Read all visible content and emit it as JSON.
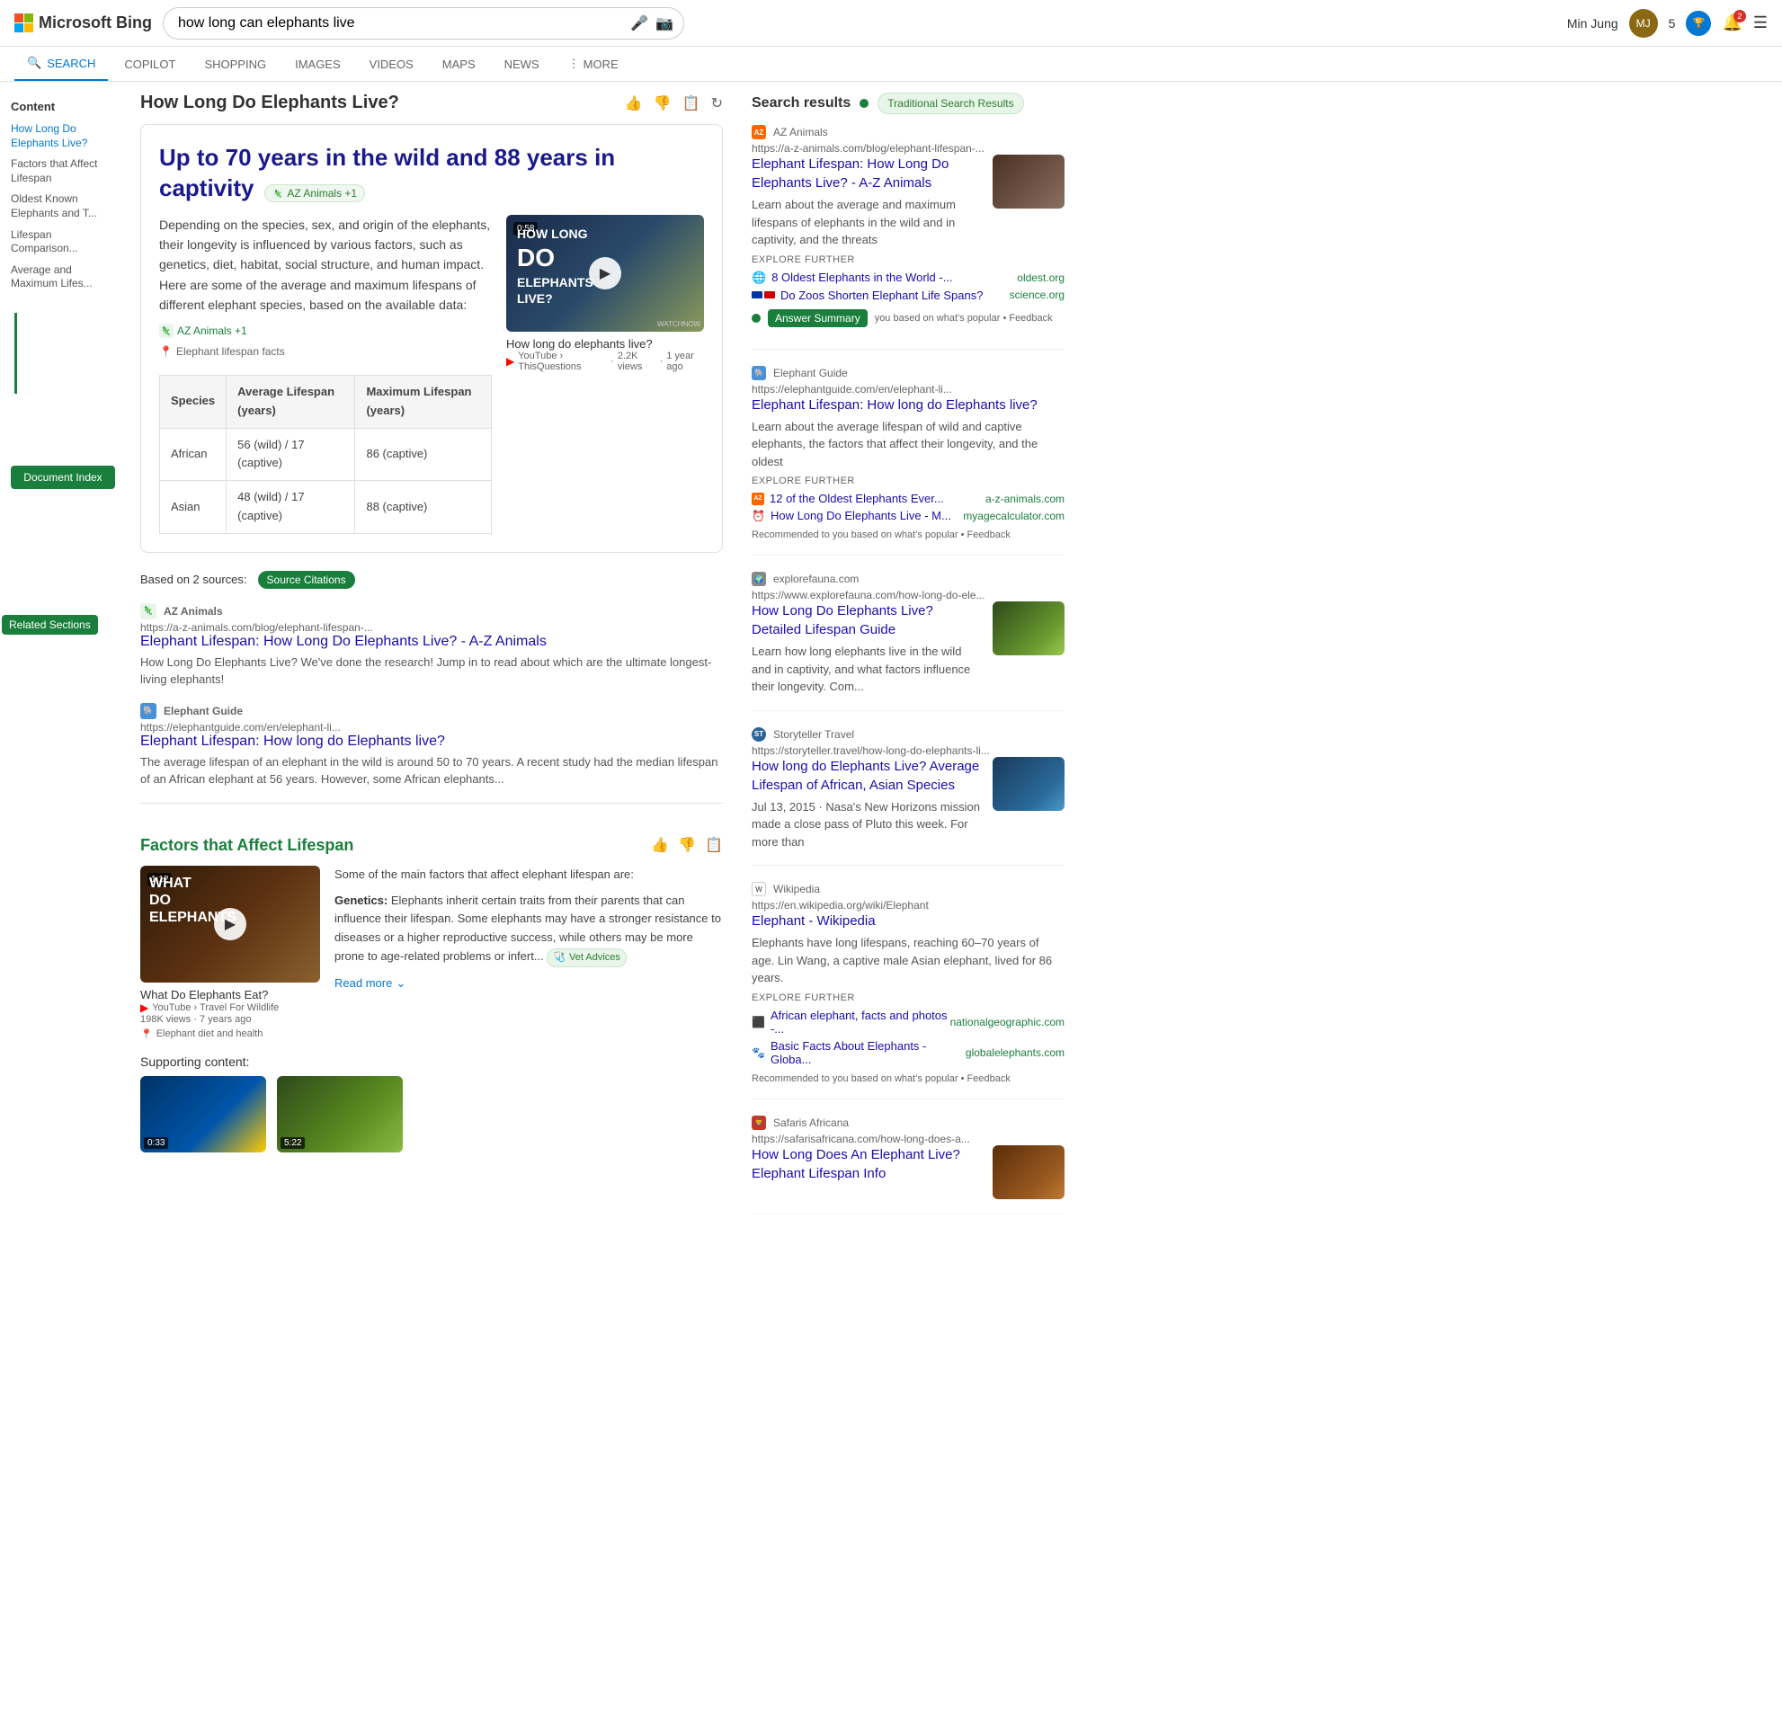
{
  "header": {
    "brand": "Microsoft Bing",
    "search_query": "how long can elephants live",
    "user_name": "Min Jung",
    "points": "5",
    "notif_count": "2"
  },
  "nav": {
    "tabs": [
      {
        "label": "SEARCH",
        "active": true,
        "icon": "search"
      },
      {
        "label": "COPILOT",
        "active": false
      },
      {
        "label": "SHOPPING",
        "active": false
      },
      {
        "label": "IMAGES",
        "active": false
      },
      {
        "label": "VIDEOS",
        "active": false
      },
      {
        "label": "MAPS",
        "active": false
      },
      {
        "label": "NEWS",
        "active": false
      },
      {
        "label": "MORE",
        "active": false,
        "has_more": true
      }
    ]
  },
  "left_sidebar": {
    "toc_title": "Content",
    "toc_items": [
      {
        "label": "How Long Do Elephants Live?",
        "active": true
      },
      {
        "label": "Factors that Affect Lifespan"
      },
      {
        "label": "Oldest Known Elephants and T..."
      },
      {
        "label": "Lifespan Comparison..."
      },
      {
        "label": "Average and Maximum Lifes..."
      }
    ],
    "doc_index_label": "Document Index",
    "related_sections_label": "Related Sections"
  },
  "main": {
    "page_title": "How Long Do Elephants Live?",
    "answer_headline": "Up to 70 years in the wild and 88 years in captivity",
    "source_badge": "AZ Animals +1",
    "answer_text": "Depending on the species, sex, and origin of the elephants, their longevity is influenced by various factors, such as genetics, diet, habitat, social structure, and human impact. Here are some of the average and maximum lifespans of different elephant species, based on the available data:",
    "answer_source_label": "AZ Animals +1",
    "elephant_facts_label": "Elephant lifespan facts",
    "video": {
      "duration": "0:58",
      "title": "How long do elephants live?",
      "channel": "YouTube › ThisQuestions",
      "views": "2.2K views",
      "time_ago": "1 year ago",
      "thumb_text_line1": "HOW LONG",
      "thumb_text_line2": "DO",
      "thumb_text_line3": "ELEPHANTS",
      "thumb_text_line4": "LIVE?"
    },
    "table": {
      "headers": [
        "Species",
        "Average Lifespan (years)",
        "Maximum Lifespan (years)"
      ],
      "rows": [
        [
          "African",
          "56 (wild) / 17 (captive)",
          "86 (captive)"
        ],
        [
          "Asian",
          "48 (wild) / 17 (captive)",
          "88 (captive)"
        ]
      ]
    },
    "sources_bar": {
      "label": "Based on 2 sources:",
      "badge_label": "Source Citations"
    },
    "sources": [
      {
        "name": "AZ Animals",
        "url": "https://a-z-animals.com/blog/elephant-lifespan-...",
        "title": "Elephant Lifespan: How Long Do Elephants Live? - A-Z Animals",
        "desc": "How Long Do Elephants Live? We've done the research! Jump in to read about which are the ultimate longest-living elephants!"
      },
      {
        "name": "Elephant Guide",
        "url": "https://elephantguide.com/en/elephant-li...",
        "title": "Elephant Lifespan: How long do Elephants live?",
        "desc": "The average lifespan of an elephant in the wild is around 50 to 70 years. A recent study had the median lifespan of an African elephant at 56 years. However, some African elephants..."
      }
    ],
    "factors_section": {
      "title": "Factors that Affect Lifespan",
      "video": {
        "duration": "1:12",
        "text_line1": "WHAT",
        "text_line2": "DO",
        "text_line3": "ELEPHANTS",
        "title": "What Do Elephants Eat?",
        "channel": "YouTube › Travel For Wildlife",
        "views": "198K views",
        "time_ago": "7 years ago"
      },
      "intro": "Some of the main factors that affect elephant lifespan are:",
      "bullets": [
        {
          "label": "Genetics:",
          "text": "Elephants inherit certain traits from their parents that can influence their lifespan. Some elephants may have a stronger resistance to diseases or a higher reproductive success, while others may be more prone to age-related problems or infert..."
        }
      ],
      "vet_badge": "Vet Advices",
      "read_more": "Read more",
      "supporting_title": "Supporting content:",
      "support_videos": [
        {
          "duration": "0:33"
        },
        {
          "duration": "5:22"
        }
      ]
    }
  },
  "right_sidebar": {
    "title": "Search results",
    "tsr_badge": "Traditional Search Results",
    "answer_summary_label": "Answer Summary",
    "results": [
      {
        "site": "AZ Animals",
        "url": "https://a-z-animals.com/blog/elephant-lifespan-...",
        "title": "Elephant Lifespan: How Long Do Elephants Live? - A-Z Animals",
        "desc": "Learn about the average and maximum lifespans of elephants in the wild and in captivity, and the threats",
        "has_image": true,
        "explore_further": [
          {
            "text": "8 Oldest Elephants in the World -...",
            "source": "oldest.org",
            "icon": "globe"
          },
          {
            "text": "Do Zoos Shorten Elephant Life Spans?",
            "source": "science.org",
            "icon": "az"
          }
        ]
      },
      {
        "site": "Elephant Guide",
        "url": "https://elephantguide.com/en/elephant-li...",
        "title": "Elephant Lifespan: How long do Elephants live?",
        "desc": "Learn about the average lifespan of wild and captive elephants, the factors that affect their longevity, and the oldest",
        "has_image": false,
        "explore_further": [
          {
            "text": "12 of the Oldest Elephants Ever...",
            "source": "a-z-animals.com",
            "icon": "az"
          },
          {
            "text": "How Long Do Elephants Live - M...",
            "source": "myagecalculator.com",
            "icon": "clock"
          }
        ],
        "recommendation": "Recommended to you based on what's popular • Feedback"
      },
      {
        "site": "explorefauna.com",
        "url": "https://www.explorefauna.com/how-long-do-ele...",
        "title": "How Long Do Elephants Live? Detailed Lifespan Guide",
        "desc": "Learn how long elephants live in the wild and in captivity, and what factors influence their longevity. Com...",
        "has_image": true
      },
      {
        "site": "Storyteller Travel",
        "url": "https://storyteller.travel/how-long-do-elephants-li...",
        "title": "How long do Elephants Live? Average Lifespan of African, Asian Species",
        "desc": "Jul 13, 2015 · Nasa's New Horizons mission made a close pass of Pluto this week. For more than",
        "has_image": true
      },
      {
        "site": "Wikipedia",
        "url": "https://en.wikipedia.org/wiki/Elephant",
        "title": "Elephant - Wikipedia",
        "desc": "Elephants have long lifespans, reaching 60–70 years of age. Lin Wang, a captive male Asian elephant, lived for 86 years.",
        "has_image": false,
        "explore_further": [
          {
            "text": "African elephant, facts and photos -...",
            "source": "nationalgeographic.com",
            "icon": "ng"
          },
          {
            "text": "Basic Facts About Elephants - Globa...",
            "source": "globalelephants.com",
            "icon": "ge"
          }
        ],
        "recommendation": "Recommended to you based on what's popular • Feedback"
      },
      {
        "site": "Safaris Africana",
        "url": "https://safarisafricana.com/how-long-does-a...",
        "title": "How Long Does An Elephant Live? Elephant Lifespan Info",
        "desc": "",
        "has_image": true
      }
    ]
  }
}
